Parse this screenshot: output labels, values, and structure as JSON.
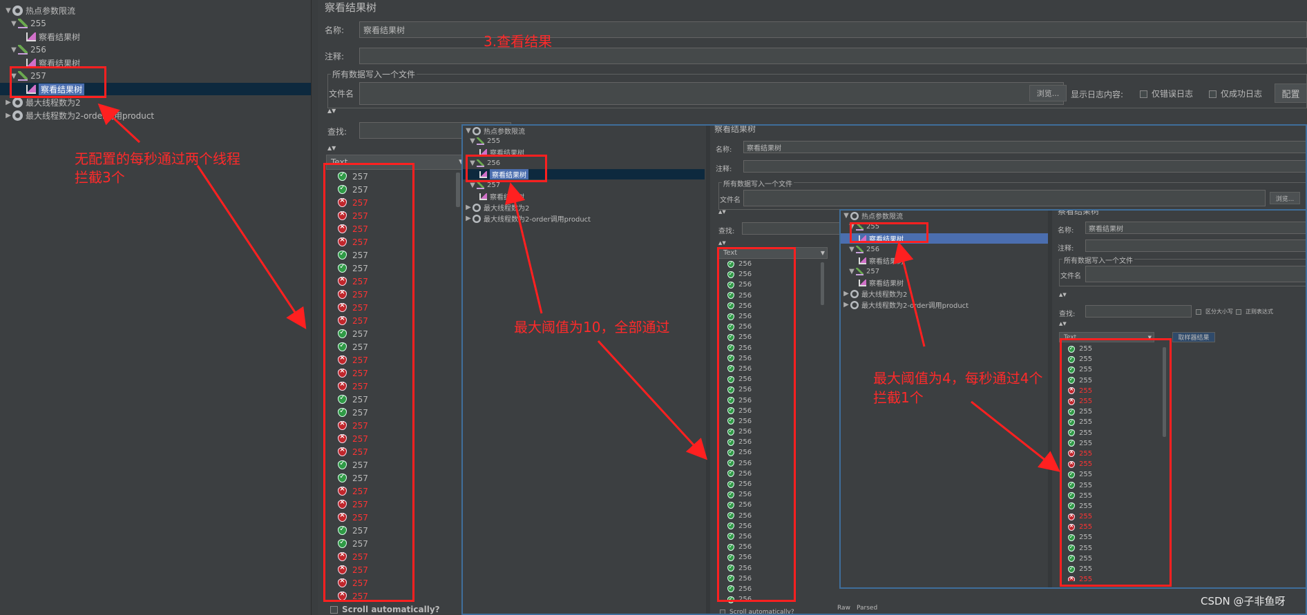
{
  "main_tree": {
    "root_label": "热点参数限流",
    "nodes": [
      {
        "label": "255"
      },
      {
        "label": "察看结果树"
      },
      {
        "label": "256"
      },
      {
        "label": "察看结果树"
      },
      {
        "label": "257"
      },
      {
        "label": "察看结果树"
      },
      {
        "label": "最大线程数为2"
      },
      {
        "label": "最大线程数为2-order调用product"
      }
    ]
  },
  "main_form": {
    "title": "察看结果树",
    "name_label": "名称:",
    "name_value": "察看结果树",
    "comment_label": "注释:",
    "group_title": "所有数据写入一个文件",
    "file_label": "文件名",
    "browse_button": "浏览...",
    "log_label": "显示日志内容:",
    "errors_only_label": "仅错误日志",
    "success_only_label": "仅成功日志",
    "config_button": "配置",
    "search_label": "查找:",
    "list_header": "Text",
    "scroll_label": "Scroll automatically?"
  },
  "results_257": [
    {
      "text": "257",
      "status": "ok"
    },
    {
      "text": "257",
      "status": "ok"
    },
    {
      "text": "257",
      "status": "bad"
    },
    {
      "text": "257",
      "status": "bad"
    },
    {
      "text": "257",
      "status": "bad"
    },
    {
      "text": "257",
      "status": "bad"
    },
    {
      "text": "257",
      "status": "ok"
    },
    {
      "text": "257",
      "status": "ok"
    },
    {
      "text": "257",
      "status": "bad"
    },
    {
      "text": "257",
      "status": "bad"
    },
    {
      "text": "257",
      "status": "bad"
    },
    {
      "text": "257",
      "status": "bad"
    },
    {
      "text": "257",
      "status": "ok"
    },
    {
      "text": "257",
      "status": "ok"
    },
    {
      "text": "257",
      "status": "bad"
    },
    {
      "text": "257",
      "status": "bad"
    },
    {
      "text": "257",
      "status": "bad"
    },
    {
      "text": "257",
      "status": "ok"
    },
    {
      "text": "257",
      "status": "ok"
    },
    {
      "text": "257",
      "status": "bad"
    },
    {
      "text": "257",
      "status": "bad"
    },
    {
      "text": "257",
      "status": "bad"
    },
    {
      "text": "257",
      "status": "ok"
    },
    {
      "text": "257",
      "status": "ok"
    },
    {
      "text": "257",
      "status": "bad"
    },
    {
      "text": "257",
      "status": "bad"
    },
    {
      "text": "257",
      "status": "bad"
    },
    {
      "text": "257",
      "status": "ok"
    },
    {
      "text": "257",
      "status": "ok"
    },
    {
      "text": "257",
      "status": "bad"
    },
    {
      "text": "257",
      "status": "bad"
    },
    {
      "text": "257",
      "status": "bad"
    },
    {
      "text": "257",
      "status": "bad"
    }
  ],
  "panel2": {
    "tree": {
      "root_label": "热点参数限流",
      "nodes": [
        {
          "label": "255"
        },
        {
          "label": "察看结果树"
        },
        {
          "label": "256"
        },
        {
          "label": "察看结果树"
        },
        {
          "label": "257"
        },
        {
          "label": "察看结果树"
        },
        {
          "label": "最大线程数为2"
        },
        {
          "label": "最大线程数为2-order调用product"
        }
      ]
    },
    "title": "察看结果树",
    "name_label": "名称:",
    "name_value": "察看结果树",
    "comment_label": "注释:",
    "group_title": "所有数据写入一个文件",
    "file_label": "文件名",
    "browse_button": "浏览...",
    "search_label": "查找:",
    "list_header": "Text",
    "scroll_label": "Scroll automatically?",
    "results": [
      {
        "text": "256",
        "status": "ok"
      },
      {
        "text": "256",
        "status": "ok"
      },
      {
        "text": "256",
        "status": "ok"
      },
      {
        "text": "256",
        "status": "ok"
      },
      {
        "text": "256",
        "status": "ok"
      },
      {
        "text": "256",
        "status": "ok"
      },
      {
        "text": "256",
        "status": "ok"
      },
      {
        "text": "256",
        "status": "ok"
      },
      {
        "text": "256",
        "status": "ok"
      },
      {
        "text": "256",
        "status": "ok"
      },
      {
        "text": "256",
        "status": "ok"
      },
      {
        "text": "256",
        "status": "ok"
      },
      {
        "text": "256",
        "status": "ok"
      },
      {
        "text": "256",
        "status": "ok"
      },
      {
        "text": "256",
        "status": "ok"
      },
      {
        "text": "256",
        "status": "ok"
      },
      {
        "text": "256",
        "status": "ok"
      },
      {
        "text": "256",
        "status": "ok"
      },
      {
        "text": "256",
        "status": "ok"
      },
      {
        "text": "256",
        "status": "ok"
      },
      {
        "text": "256",
        "status": "ok"
      },
      {
        "text": "256",
        "status": "ok"
      },
      {
        "text": "256",
        "status": "ok"
      },
      {
        "text": "256",
        "status": "ok"
      },
      {
        "text": "256",
        "status": "ok"
      },
      {
        "text": "256",
        "status": "ok"
      },
      {
        "text": "256",
        "status": "ok"
      },
      {
        "text": "256",
        "status": "ok"
      },
      {
        "text": "256",
        "status": "ok"
      },
      {
        "text": "256",
        "status": "ok"
      },
      {
        "text": "256",
        "status": "ok"
      },
      {
        "text": "256",
        "status": "ok"
      },
      {
        "text": "256",
        "status": "ok"
      }
    ]
  },
  "panel3": {
    "tree": {
      "root_label": "热点参数限流",
      "nodes": [
        {
          "label": "255"
        },
        {
          "label": "察看结果树"
        },
        {
          "label": "256"
        },
        {
          "label": "察看结果树"
        },
        {
          "label": "257"
        },
        {
          "label": "察看结果树"
        },
        {
          "label": "最大线程数为2"
        },
        {
          "label": "最大线程数为2-order调用product"
        }
      ]
    },
    "title": "察看结果树",
    "name_label": "名称:",
    "name_value": "察看结果树",
    "comment_label": "注释:",
    "group_title": "所有数据写入一个文件",
    "file_label": "文件名",
    "search_label": "查找:",
    "case_label": "区分大小写",
    "regex_label": "正则表达式",
    "list_header": "Text",
    "extractor_tab": "取样器结果",
    "bottom_tabs": [
      "Raw",
      "Parsed"
    ],
    "results": [
      {
        "text": "255",
        "status": "ok"
      },
      {
        "text": "255",
        "status": "ok"
      },
      {
        "text": "255",
        "status": "ok"
      },
      {
        "text": "255",
        "status": "ok"
      },
      {
        "text": "255",
        "status": "bad"
      },
      {
        "text": "255",
        "status": "bad"
      },
      {
        "text": "255",
        "status": "ok"
      },
      {
        "text": "255",
        "status": "ok"
      },
      {
        "text": "255",
        "status": "ok"
      },
      {
        "text": "255",
        "status": "ok"
      },
      {
        "text": "255",
        "status": "bad"
      },
      {
        "text": "255",
        "status": "bad"
      },
      {
        "text": "255",
        "status": "ok"
      },
      {
        "text": "255",
        "status": "ok"
      },
      {
        "text": "255",
        "status": "ok"
      },
      {
        "text": "255",
        "status": "ok"
      },
      {
        "text": "255",
        "status": "bad"
      },
      {
        "text": "255",
        "status": "bad"
      },
      {
        "text": "255",
        "status": "ok"
      },
      {
        "text": "255",
        "status": "ok"
      },
      {
        "text": "255",
        "status": "ok"
      },
      {
        "text": "255",
        "status": "ok"
      },
      {
        "text": "255",
        "status": "bad"
      }
    ]
  },
  "annotations": {
    "step3": "3.查看结果",
    "note_left_line1": "无配置的每秒通过两个线程",
    "note_left_line2": "拦截3个",
    "note_mid": "最大阈值为10，全部通过",
    "note_right_line1": "最大阈值为4，每秒通过4个",
    "note_right_line2": "拦截1个"
  },
  "watermark": "CSDN @子非鱼呀",
  "colors": {
    "background": "#3c3f41",
    "selection": "#4b6eaf",
    "annotation": "#ff2020",
    "ok": "#2f9a45",
    "error": "#c0262b",
    "error_text": "#ff3333"
  }
}
